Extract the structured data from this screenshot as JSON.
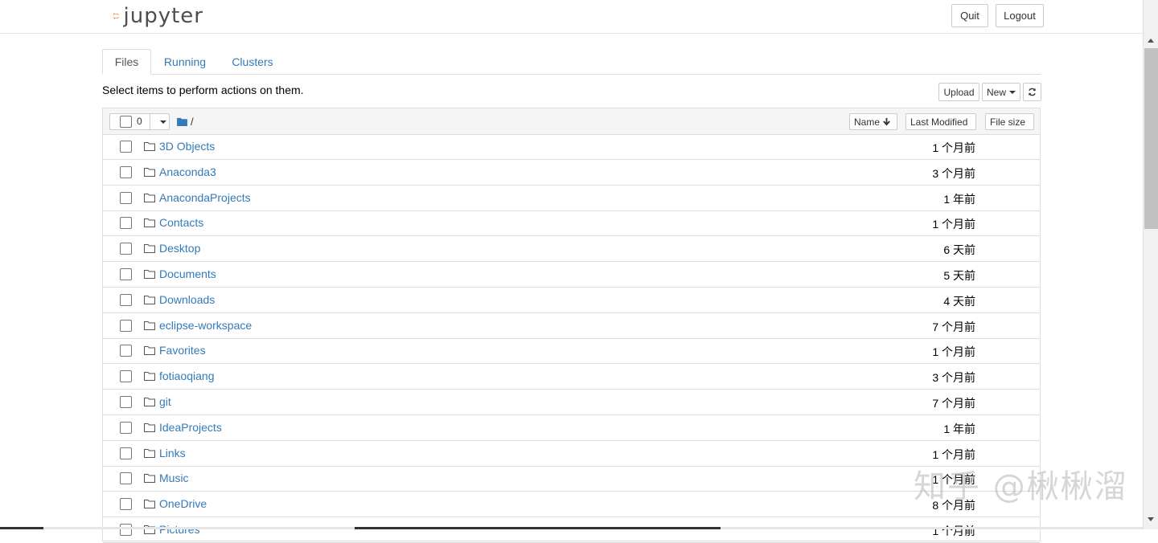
{
  "header": {
    "logo_text": "jupyter",
    "quit_label": "Quit",
    "logout_label": "Logout"
  },
  "tabs": [
    {
      "label": "Files",
      "active": true
    },
    {
      "label": "Running",
      "active": false
    },
    {
      "label": "Clusters",
      "active": false
    }
  ],
  "toolbar": {
    "instructions": "Select items to perform actions on them.",
    "upload_label": "Upload",
    "new_label": "New",
    "refresh_icon": "refresh-icon"
  },
  "list_header": {
    "selected_count": "0",
    "breadcrumb": "/",
    "sort_name_label": "Name",
    "sort_modified_label": "Last Modified",
    "sort_size_label": "File size"
  },
  "files": [
    {
      "name": "3D Objects",
      "modified": "1 个月前"
    },
    {
      "name": "Anaconda3",
      "modified": "3 个月前"
    },
    {
      "name": "AnacondaProjects",
      "modified": "1 年前"
    },
    {
      "name": "Contacts",
      "modified": "1 个月前"
    },
    {
      "name": "Desktop",
      "modified": "6 天前"
    },
    {
      "name": "Documents",
      "modified": "5 天前"
    },
    {
      "name": "Downloads",
      "modified": "4 天前"
    },
    {
      "name": "eclipse-workspace",
      "modified": "7 个月前"
    },
    {
      "name": "Favorites",
      "modified": "1 个月前"
    },
    {
      "name": "fotiaoqiang",
      "modified": "3 个月前"
    },
    {
      "name": "git",
      "modified": "7 个月前"
    },
    {
      "name": "IdeaProjects",
      "modified": "1 年前"
    },
    {
      "name": "Links",
      "modified": "1 个月前"
    },
    {
      "name": "Music",
      "modified": "1 个月前"
    },
    {
      "name": "OneDrive",
      "modified": "8 个月前"
    },
    {
      "name": "Pictures",
      "modified": "1 个月前"
    }
  ],
  "watermark": "知乎 @楸楸溜",
  "colors": {
    "link": "#337ab7",
    "logo_orange": "#f37726"
  }
}
